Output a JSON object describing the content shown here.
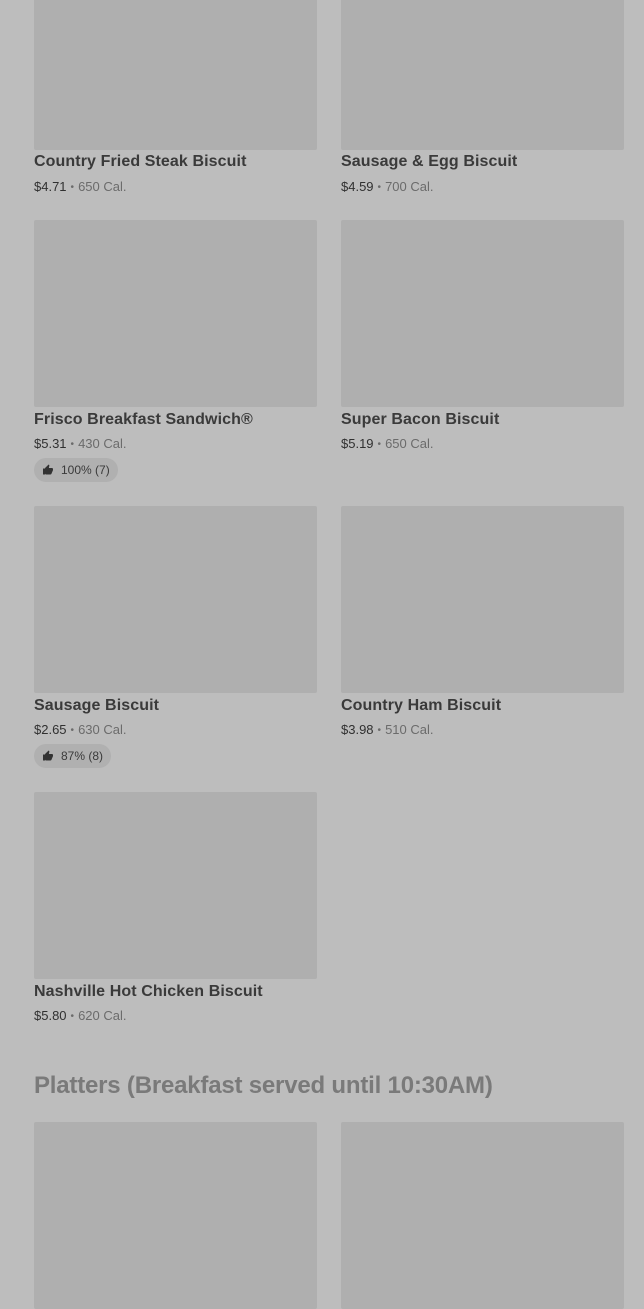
{
  "items": [
    {
      "name": "Country Fried Steak Biscuit",
      "price": "$4.71",
      "cal": "650 Cal."
    },
    {
      "name": "Sausage & Egg Biscuit",
      "price": "$4.59",
      "cal": "700 Cal."
    },
    {
      "name": "Frisco Breakfast Sandwich®",
      "price": "$5.31",
      "cal": "430 Cal.",
      "rating": "100% (7)"
    },
    {
      "name": "Super Bacon Biscuit",
      "price": "$5.19",
      "cal": "650 Cal."
    },
    {
      "name": "Sausage Biscuit",
      "price": "$2.65",
      "cal": "630 Cal.",
      "rating": "87% (8)"
    },
    {
      "name": "Country Ham Biscuit",
      "price": "$3.98",
      "cal": "510 Cal."
    },
    {
      "name": "Nashville Hot Chicken Biscuit",
      "price": "$5.80",
      "cal": "620 Cal."
    }
  ],
  "sections": {
    "platters_title": "Platters (Breakfast served until 10:30AM)"
  },
  "separator": "•"
}
